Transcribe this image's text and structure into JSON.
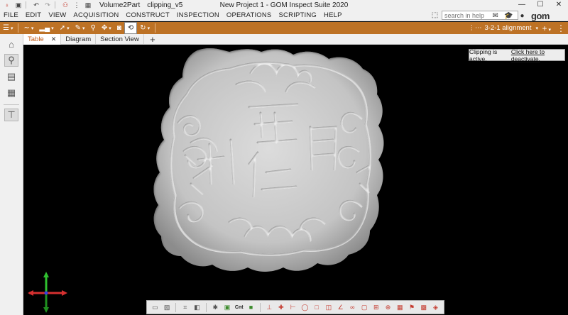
{
  "titlebar": {
    "tabs": [
      "Volume2Part",
      "clipping_v5"
    ],
    "window_title": "New Project 1 - GOM Inspect Suite 2020",
    "minimize": "—",
    "maximize": "☐",
    "close": "✕"
  },
  "menu": {
    "items": [
      "FILE",
      "EDIT",
      "VIEW",
      "ACQUISITION",
      "CONSTRUCT",
      "INSPECTION",
      "OPERATIONS",
      "SCRIPTING",
      "HELP"
    ],
    "search_placeholder": "search in help",
    "logo": "gom"
  },
  "toolbar": {
    "alignment_label": "3-2-1 alignment"
  },
  "view_tabs": [
    {
      "label": "Table",
      "close": "✕"
    },
    {
      "label": "Diagram"
    },
    {
      "label": "Section View"
    }
  ],
  "add_tab": "+",
  "clip_notice": {
    "text": "Clipping is active.",
    "link": "Click here to deactivate."
  },
  "axis_colors": {
    "x": "#d63030",
    "y": "#2fbf2f",
    "z": "#3a3adf"
  },
  "bottom_toolbar": {
    "label_cnt": "Cnt"
  }
}
